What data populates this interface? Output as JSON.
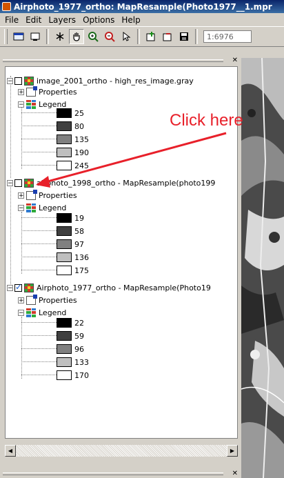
{
  "window": {
    "title": "Airphoto_1977_ortho: MapResample(Photo1977__1.mpr"
  },
  "menu": [
    "File",
    "Edit",
    "Layers",
    "Options",
    "Help"
  ],
  "toolbar": {
    "icons": [
      "map-window-icon",
      "overview-icon",
      "pointer-star-icon",
      "pan-hand-icon",
      "zoom-in-icon",
      "zoom-out-icon",
      "select-arrow-icon",
      "add-layer-icon",
      "remove-layer-icon",
      "save-icon"
    ],
    "scale": "1:6976"
  },
  "layers": [
    {
      "name": "image_2001_ortho - high_res_image.gray",
      "checked": false,
      "properties_label": "Properties",
      "legend_label": "Legend",
      "legend": [
        {
          "value": "25",
          "color": "#000000"
        },
        {
          "value": "80",
          "color": "#404040"
        },
        {
          "value": "135",
          "color": "#808080"
        },
        {
          "value": "190",
          "color": "#bfbfbf"
        },
        {
          "value": "245",
          "color": "#ffffff"
        }
      ]
    },
    {
      "name": "airphoto_1998_ortho - MapResample(photo199",
      "checked": false,
      "properties_label": "Properties",
      "legend_label": "Legend",
      "legend": [
        {
          "value": "19",
          "color": "#000000"
        },
        {
          "value": "58",
          "color": "#404040"
        },
        {
          "value": "97",
          "color": "#808080"
        },
        {
          "value": "136",
          "color": "#bfbfbf"
        },
        {
          "value": "175",
          "color": "#ffffff"
        }
      ]
    },
    {
      "name": "Airphoto_1977_ortho - MapResample(Photo19",
      "checked": true,
      "properties_label": "Properties",
      "legend_label": "Legend",
      "legend": [
        {
          "value": "22",
          "color": "#000000"
        },
        {
          "value": "59",
          "color": "#404040"
        },
        {
          "value": "96",
          "color": "#808080"
        },
        {
          "value": "133",
          "color": "#bfbfbf"
        },
        {
          "value": "170",
          "color": "#ffffff"
        }
      ]
    }
  ],
  "annotation": {
    "text": "Click here",
    "color": "#e8202a"
  }
}
